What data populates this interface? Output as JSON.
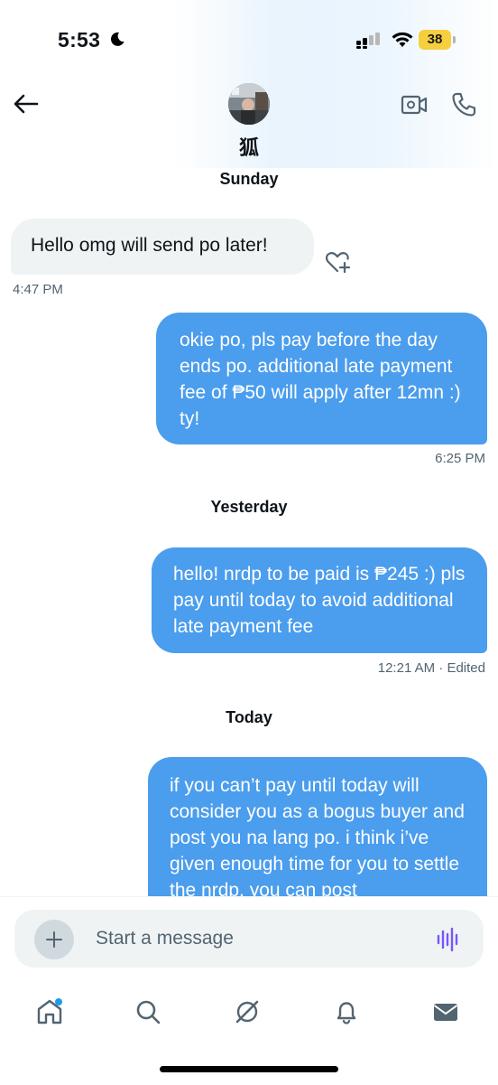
{
  "status_bar": {
    "time": "5:53",
    "battery": "38",
    "battery_color": "#f6cf3e"
  },
  "header": {
    "contact_name": "狐",
    "back_icon": "arrow-left-icon",
    "video_icon": "video-call-icon",
    "phone_icon": "phone-icon"
  },
  "messages": [
    {
      "day": "Sunday"
    },
    {
      "direction": "in",
      "text": "Hello omg will send po later!",
      "time": "4:47 PM"
    },
    {
      "direction": "out",
      "text": "okie po, pls pay before the day ends po. additional late payment fee of ₱50 will apply after 12mn :) ty!",
      "time": "6:25 PM"
    },
    {
      "day": "Yesterday"
    },
    {
      "direction": "out",
      "text": "hello! nrdp to be paid is ₱245 :) pls pay until today to avoid additional late payment fee",
      "time": "12:21 AM · Edited"
    },
    {
      "day": "Today"
    },
    {
      "direction": "out",
      "text": "if you can’t pay until today will consider you as a bogus buyer and post you na lang po. i think i’ve given enough time for you to settle the nrdp. you can post",
      "time": ""
    }
  ],
  "composer": {
    "placeholder": "Start a message"
  },
  "tabs": [
    {
      "name": "home-icon"
    },
    {
      "name": "search-icon"
    },
    {
      "name": "grok-icon"
    },
    {
      "name": "notifications-icon"
    },
    {
      "name": "messages-icon"
    }
  ],
  "colors": {
    "outgoing_bubble": "#4b9ded",
    "incoming_bubble": "#eff3f4",
    "accent": "#1d9bf0",
    "voice_accent": "#7856ff"
  }
}
